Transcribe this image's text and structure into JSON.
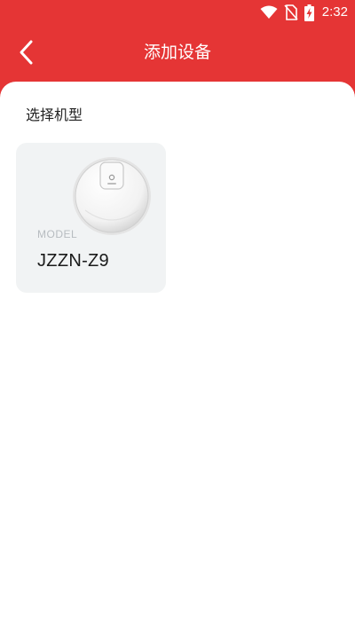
{
  "status_bar": {
    "time": "2:32",
    "icons": [
      "wifi-icon",
      "no-sim-icon",
      "battery-charging-icon"
    ]
  },
  "header": {
    "title": "添加设备",
    "back_icon": "chevron-left-icon",
    "background_color": "#e53535"
  },
  "section": {
    "title": "选择机型"
  },
  "models": [
    {
      "caption": "MODEL",
      "name": "JZZN-Z9",
      "image_icon": "robot-vacuum-icon"
    }
  ]
}
